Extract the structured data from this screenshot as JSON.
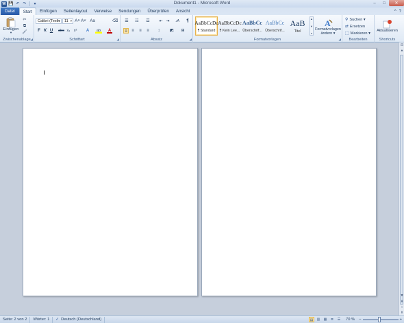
{
  "window": {
    "title": "Dokument1 - Microsoft Word",
    "controls": {
      "minimize": "–",
      "maximize": "□",
      "close": "✕"
    }
  },
  "quick_access": {
    "app_icon": "W",
    "save": "💾",
    "undo": "↶",
    "redo": "↷",
    "customize": "▾"
  },
  "tabs": {
    "file": "Datei",
    "items": [
      "Start",
      "Einfügen",
      "Seitenlayout",
      "Verweise",
      "Sendungen",
      "Überprüfen",
      "Ansicht"
    ],
    "active": "Start",
    "help_icons": {
      "minimize_ribbon": "^",
      "help": "?"
    }
  },
  "ribbon": {
    "clipboard": {
      "label": "Zwischenablage",
      "paste_label": "Einfügen",
      "paste_dropdown": "▾",
      "cut_icon": "✂",
      "copy_icon": "⧉",
      "format_painter_icon": "🖌"
    },
    "font": {
      "label": "Schriftart",
      "font_name": "Calibri (Textk",
      "font_size": "11",
      "grow": "A˄",
      "shrink": "A˅",
      "case": "Aa",
      "clear": "⌫",
      "bold": "F",
      "italic": "K",
      "underline": "U",
      "strike": "abc",
      "subscript": "x₂",
      "superscript": "x²",
      "text_effects": "A",
      "highlight": "ab",
      "font_color": "A"
    },
    "paragraph": {
      "label": "Absatz",
      "bullets": "☰",
      "numbering": "☷",
      "multilevel": "☲",
      "decrease_indent": "⇤",
      "increase_indent": "⇥",
      "sort": "↓A",
      "show_marks": "¶",
      "align_left": "≡",
      "align_center": "≡",
      "align_right": "≡",
      "justify": "≡",
      "line_spacing": "↕",
      "shading": "◩",
      "borders": "⊞"
    },
    "styles": {
      "label": "Formatvorlagen",
      "items": [
        {
          "preview": "AaBbCcDc",
          "name": "¶ Standard",
          "selected": true,
          "color": "#222222"
        },
        {
          "preview": "AaBbCcDc",
          "name": "¶ Kein Lee...",
          "selected": false,
          "color": "#222222"
        },
        {
          "preview": "AaBbCс",
          "name": "Überschrif...",
          "selected": false,
          "color": "#365f91"
        },
        {
          "preview": "AaBbCc",
          "name": "Überschrif...",
          "selected": false,
          "color": "#4f81bd"
        },
        {
          "preview": "AaB",
          "name": "Titel",
          "selected": false,
          "color": "#17365d"
        }
      ],
      "change_label_1": "Formatvorlagen",
      "change_label_2": "ändern ▾"
    },
    "editing": {
      "label": "Bearbeiten",
      "find": "Suchen ▾",
      "replace": "Ersetzen",
      "select": "Markieren ▾"
    },
    "shortcuts": {
      "label": "Shortcuts",
      "activate": "Aktualisieren"
    }
  },
  "document": {
    "pages_shown": 2,
    "cursor_mark": "ı"
  },
  "status_bar": {
    "page": "Seite: 2 von 2",
    "words": "Wörter: 1",
    "language": "Deutsch (Deutschland)",
    "zoom": "70 %",
    "zoom_out": "−",
    "zoom_in": "+",
    "zoom_level": 0.45
  },
  "scrollbar": {
    "up": "▲",
    "down": "▼",
    "prev_page": "⇞",
    "browse": "○",
    "next_page": "⇟"
  }
}
